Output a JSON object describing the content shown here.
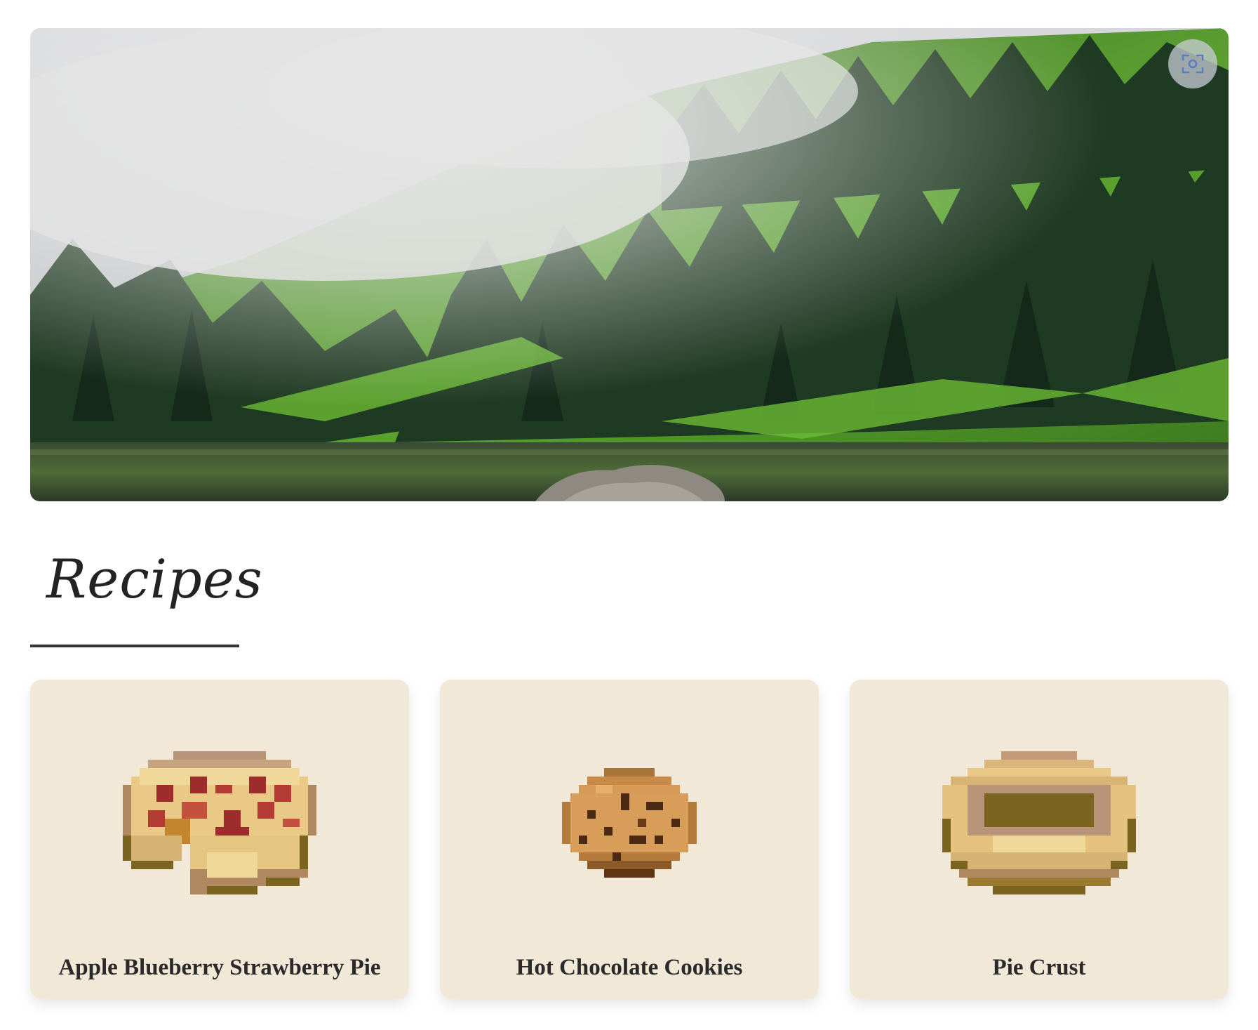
{
  "hero": {
    "image": "misty forested mountainside reflected in a lake",
    "lens_icon": "visual-search-icon"
  },
  "section": {
    "heading": "Recipes"
  },
  "recipes": [
    {
      "title": "Apple Blueberry Strawberry Pie",
      "icon": "pixel-pie-slice-icon"
    },
    {
      "title": "Hot Chocolate Cookies",
      "icon": "pixel-cookie-icon"
    },
    {
      "title": "Pie Crust",
      "icon": "pixel-pie-crust-icon"
    }
  ],
  "colors": {
    "card_background": "#f2e8d8",
    "heading_rule": "#333333",
    "title_text": "#2a2a2a"
  }
}
